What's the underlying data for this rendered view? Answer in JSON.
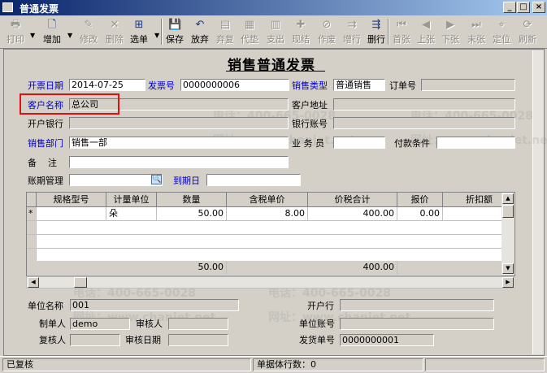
{
  "window": {
    "title": "普通发票"
  },
  "toolbar": {
    "print": "打印",
    "add": "增加",
    "edit": "修改",
    "delete": "删除",
    "select": "选单",
    "save": "保存",
    "discard": "放弃",
    "review": "弃复",
    "prepay": "代垫",
    "expense": "支出",
    "spec": "现结",
    "void": "作废",
    "add_row": "增行",
    "del_row": "删行",
    "first": "首张",
    "prev": "上张",
    "next": "下张",
    "last": "末张",
    "locate": "定位",
    "refresh": "刷新"
  },
  "doc": {
    "title": "销售普通发票",
    "invoice_date_label": "开票日期",
    "invoice_date": "2014-07-25",
    "invoice_no_label": "发票号",
    "invoice_no": "0000000006",
    "sales_type_label": "销售类型",
    "sales_type": "普通销售",
    "order_no_label": "订单号",
    "order_no": "",
    "customer_label": "客户名称",
    "customer": "总公司",
    "customer_addr_label": "客户地址",
    "customer_addr": "",
    "bank_label": "开户银行",
    "bank": "",
    "bank_acct_label": "银行账号",
    "bank_acct": "",
    "dept_label": "销售部门",
    "dept": "销售一部",
    "salesman_label": "业 务 员",
    "salesman": "",
    "pay_terms_label": "付款条件",
    "pay_terms": "",
    "remark_label": "备    注",
    "remark": "",
    "aging_label": "账期管理",
    "aging": "",
    "due_date_label": "到期日",
    "due_date": ""
  },
  "grid": {
    "headers": [
      "规格型号",
      "计量单位",
      "数量",
      "含税单价",
      "价税合计",
      "报价",
      "折扣额"
    ],
    "rows": [
      {
        "marker": "*",
        "spec": "",
        "unit": "朵",
        "qty": "50.00",
        "price": "8.00",
        "total": "400.00",
        "quote": "0.00",
        "discount": "0"
      }
    ],
    "summary": {
      "qty": "50.00",
      "total": "400.00"
    }
  },
  "footer": {
    "unit_name_label": "单位名称",
    "unit_name": "001",
    "open_bank_label": "开户行",
    "open_bank": "",
    "maker_label": "制单人",
    "maker": "demo",
    "auditor_label": "审核人",
    "auditor": "",
    "unit_acct_label": "单位账号",
    "unit_acct": "",
    "rechecker_label": "复核人",
    "rechecker": "",
    "audit_date_label": "审核日期",
    "audit_date": "",
    "delivery_no_label": "发货单号",
    "delivery_no": "0000000001"
  },
  "status": {
    "state": "已复核",
    "rows_label": "单据体行数：0"
  },
  "watermark": {
    "phone": "电话：400-665-0028",
    "site": "网址：www.chanjet.net"
  },
  "colors": {
    "highlight": "#e01010",
    "label_blue": "#0000c8"
  }
}
